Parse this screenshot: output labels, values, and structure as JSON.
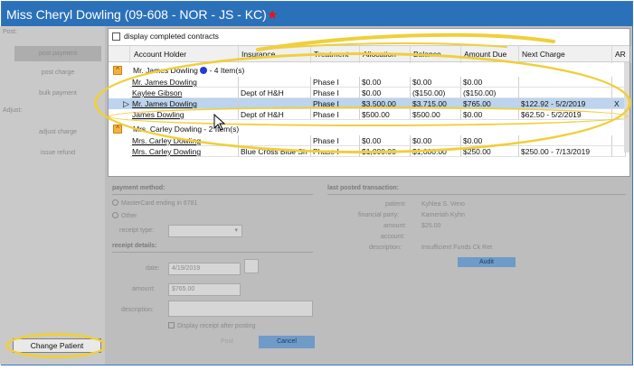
{
  "window": {
    "title": "Miss Cheryl Dowling (09-608 - NOR - JS - KC)",
    "title_star": "★"
  },
  "sidebar": {
    "post_heading": "Post:",
    "post_items": [
      "post payment",
      "post charge",
      "bulk payment"
    ],
    "adjust_heading": "Adjust:",
    "adjust_items": [
      "adjust charge",
      "issue refund"
    ],
    "change_patient": "Change Patient"
  },
  "grid": {
    "display_completed": "display completed contracts",
    "columns": [
      "Account Holder",
      "Insurance",
      "Treatment",
      "Allocation",
      "Balance",
      "Amount Due",
      "Next Charge",
      "AR"
    ],
    "groups": [
      {
        "toggle": "^",
        "label": "Mr. James Dowling",
        "status_dot_color": "#1f3dd8",
        "count": "- 4 Item(s)",
        "rows": [
          {
            "holder": "Mr. James Dowling",
            "insurance": "",
            "treatment": "Phase I",
            "allocation": "$0.00",
            "balance": "$0.00",
            "amount_due": "$0.00",
            "next_charge": "",
            "ar": ""
          },
          {
            "holder": "Kaylee Gibson",
            "insurance": "Dept of H&H",
            "treatment": "Phase I",
            "allocation": "$0.00",
            "balance": "($150.00)",
            "amount_due": "($150.00)",
            "next_charge": "",
            "ar": ""
          },
          {
            "holder": "Mr. James Dowling",
            "insurance": "",
            "treatment": "Phase I",
            "allocation": "$3,500.00",
            "balance": "$3,715.00",
            "amount_due": "$765.00",
            "next_charge": "$122.92 - 5/2/2019",
            "ar": "X",
            "selected": true
          },
          {
            "holder": "James Dowling",
            "insurance": "Dept of H&H",
            "treatment": "Phase I",
            "allocation": "$500.00",
            "balance": "$500.00",
            "amount_due": "$0.00",
            "next_charge": "$62.50 - 5/2/2019",
            "ar": ""
          }
        ]
      },
      {
        "toggle": "^",
        "label": "Mrs. Carley Dowling",
        "count": "- 2 Item(s)",
        "rows": [
          {
            "holder": "Mrs. Carley Dowling",
            "insurance": "",
            "treatment": "Phase I",
            "allocation": "$0.00",
            "balance": "$0.00",
            "amount_due": "$0.00",
            "next_charge": "",
            "ar": ""
          },
          {
            "holder": "Mrs. Carley Dowling",
            "insurance": "Blue Cross Blue Sh",
            "treatment": "Phase I",
            "allocation": "$1,000.00",
            "balance": "$1,000.00",
            "amount_due": "$250.00",
            "next_charge": "$250.00 - 7/13/2019",
            "ar": ""
          }
        ]
      }
    ],
    "selected_marker": "▷"
  },
  "payment": {
    "method_heading": "payment method:",
    "method_card": "MasterCard ending in 6781",
    "method_other": "Other",
    "receipt_type_label": "receipt type:",
    "receipt_details_heading": "receipt details:",
    "date_label": "date:",
    "date_value": "4/19/2019",
    "amount_label": "amount:",
    "amount_value": "$765.00",
    "description_label": "description:",
    "display_receipt": "Display receipt after posting",
    "post_button": "Post",
    "cancel_button": "Cancel"
  },
  "last_posted": {
    "heading": "last posted transaction:",
    "patient_label": "patient:",
    "patient_value": "Kyhlea S. Veno",
    "financial_party_label": "financial party:",
    "financial_party_value": "Kameriah Kyhn",
    "amount_label": "amount:",
    "amount_value": "$25.00",
    "account_label": "account:",
    "description_label": "description:",
    "description_value": "Insufficient Funds Ck Ret",
    "audit_button": "Audit"
  },
  "colors": {
    "title_bar": "#2b71b9",
    "highlight": "#f0cf3a",
    "selected_row": "#bcd4ee",
    "group_toggle": "#f3b23a"
  }
}
